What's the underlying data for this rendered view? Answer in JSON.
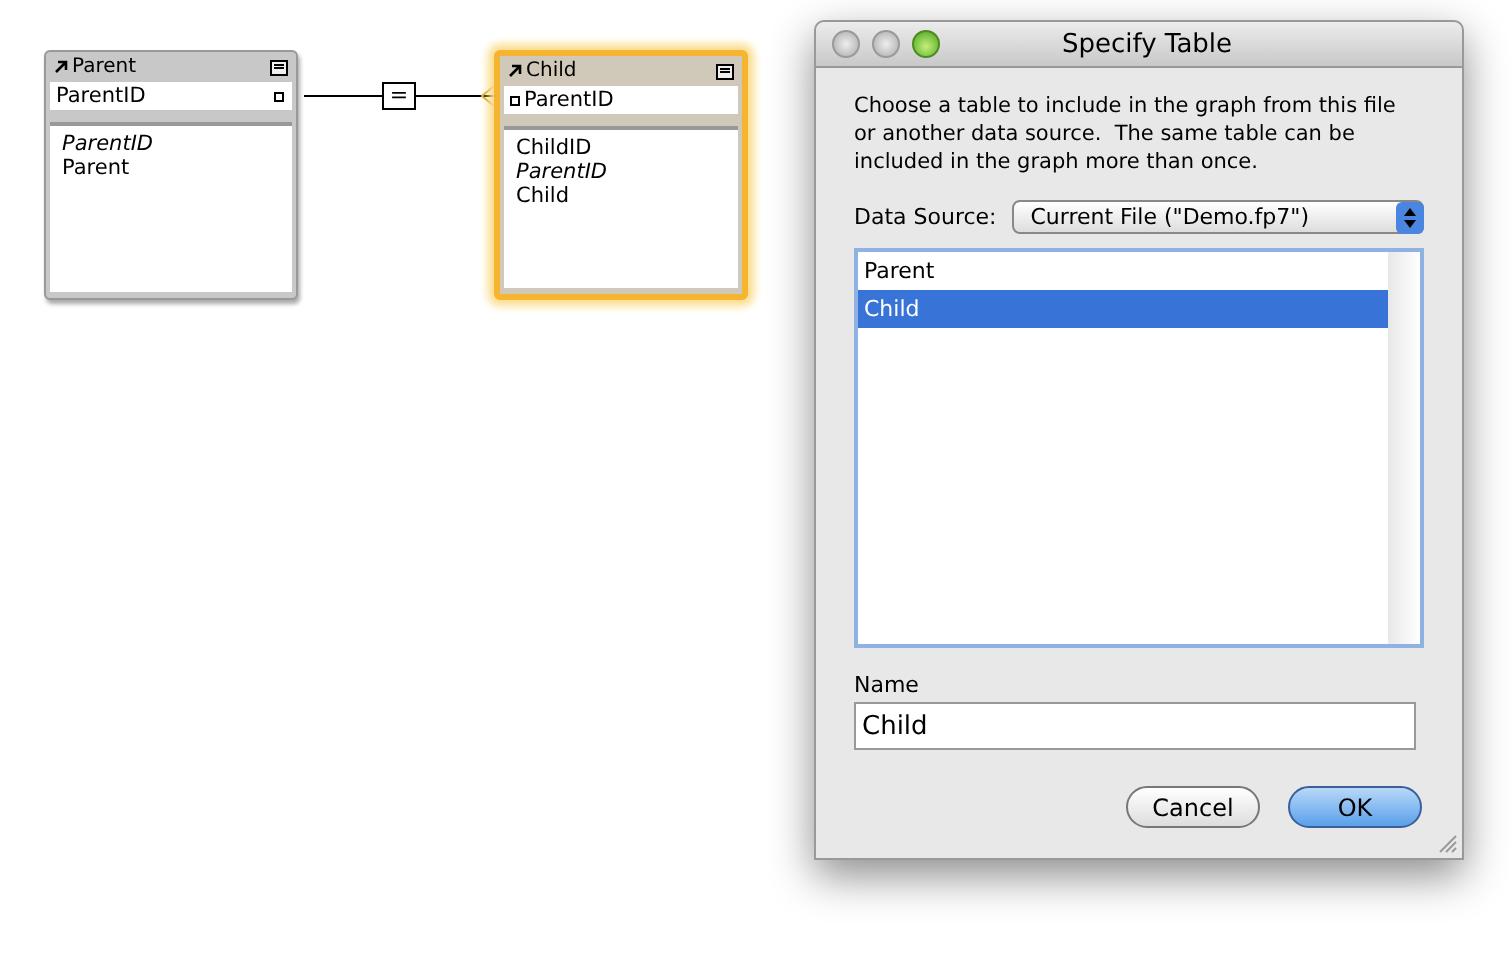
{
  "tables": [
    {
      "name": "Parent",
      "selected": false,
      "key_field": {
        "name": "ParentID"
      },
      "fields": [
        {
          "name": "ParentID",
          "italic": true
        },
        {
          "name": "Parent",
          "italic": false
        }
      ]
    },
    {
      "name": "Child",
      "selected": true,
      "key_field": {
        "name": "ParentID"
      },
      "fields": [
        {
          "name": "ChildID",
          "italic": false
        },
        {
          "name": "ParentID",
          "italic": true
        },
        {
          "name": "Child",
          "italic": false
        }
      ]
    }
  ],
  "relationship": {
    "operator": "="
  },
  "dialog": {
    "title": "Specify Table",
    "description": "Choose a table to include in the graph from this file or another data source.  The same table can be included in the graph more than once.",
    "data_source": {
      "label": "Data Source:",
      "value": "Current File (\"Demo.fp7\")"
    },
    "tables": [
      {
        "label": "Parent",
        "selected": false
      },
      {
        "label": "Child",
        "selected": true
      }
    ],
    "name": {
      "label": "Name",
      "value": "Child"
    },
    "buttons": [
      {
        "label": "Cancel",
        "default": false
      },
      {
        "label": "OK",
        "default": true
      }
    ]
  }
}
